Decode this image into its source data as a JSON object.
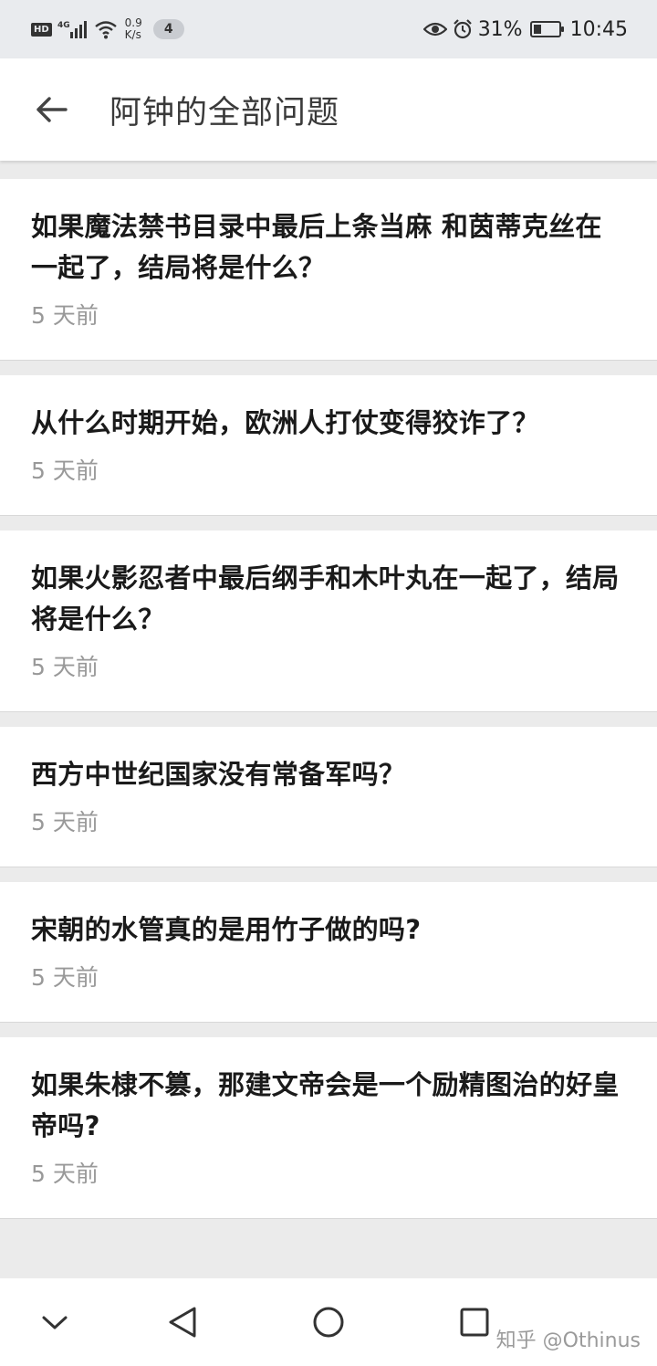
{
  "status_bar": {
    "hd": "HD",
    "network": "4G",
    "speed_value": "0.9",
    "speed_unit": "K/s",
    "notification_count": "4",
    "battery": "31%",
    "battery_level": 0.31,
    "time": "10:45"
  },
  "header": {
    "title": "阿钟的全部问题"
  },
  "questions": [
    {
      "title": "如果魔法禁书目录中最后上条当麻 和茵蒂克丝在一起了，结局将是什么？",
      "time": "5 天前"
    },
    {
      "title": "从什么时期开始，欧洲人打仗变得狡诈了？",
      "time": "5 天前"
    },
    {
      "title": "如果火影忍者中最后纲手和木叶丸在一起了，结局将是什么？",
      "time": "5 天前"
    },
    {
      "title": "西方中世纪国家没有常备军吗？",
      "time": "5 天前"
    },
    {
      "title": "宋朝的水管真的是用竹子做的吗?",
      "time": "5 天前"
    },
    {
      "title": "如果朱棣不篡，那建文帝会是一个励精图治的好皇帝吗?",
      "time": "5 天前"
    }
  ],
  "watermark": "知乎 @Othinus",
  "colors": {
    "background": "#ebebeb",
    "card": "#ffffff",
    "title_text": "#1a1a1a",
    "meta_text": "#999999"
  }
}
